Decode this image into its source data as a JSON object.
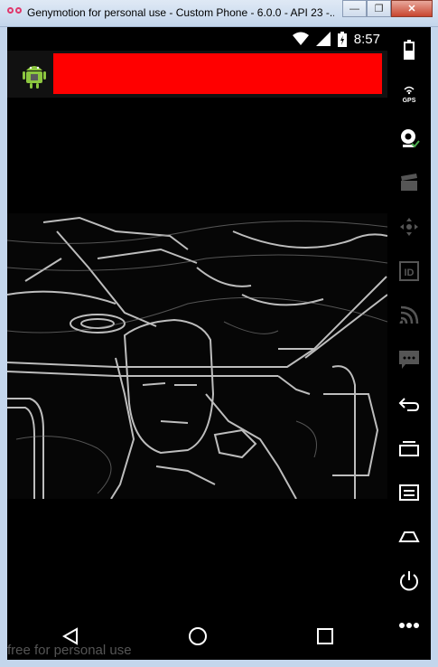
{
  "window": {
    "title": "Genymotion for personal use - Custom Phone - 6.0.0 - API 23 -...",
    "minimize_glyph": "—",
    "restore_glyph": "❐",
    "close_glyph": "✕"
  },
  "statusbar": {
    "time": "8:57",
    "icons": [
      "wifi-icon",
      "signal-icon",
      "battery-icon"
    ]
  },
  "actionbar": {
    "logo": "android-robot-icon",
    "title_block_color": "#ff0000"
  },
  "navbar": {
    "buttons": [
      "back-icon",
      "home-icon",
      "recents-icon"
    ]
  },
  "watermark": "free for personal use",
  "sidebar": {
    "tools": [
      {
        "name": "battery-tool",
        "label": ""
      },
      {
        "name": "gps-tool",
        "label": "GPS"
      },
      {
        "name": "webcam-tool",
        "label": ""
      },
      {
        "name": "capture-tool",
        "label": ""
      },
      {
        "name": "remote-control-tool",
        "label": ""
      },
      {
        "name": "device-id-tool",
        "label": "ID"
      },
      {
        "name": "cast-tool",
        "label": ""
      },
      {
        "name": "sms-tool",
        "label": ""
      },
      {
        "name": "back-tool",
        "label": ""
      },
      {
        "name": "recent-apps-tool",
        "label": ""
      },
      {
        "name": "menu-tool",
        "label": ""
      },
      {
        "name": "home-tool",
        "label": ""
      },
      {
        "name": "power-tool",
        "label": ""
      },
      {
        "name": "more-tool",
        "label": ""
      }
    ]
  }
}
